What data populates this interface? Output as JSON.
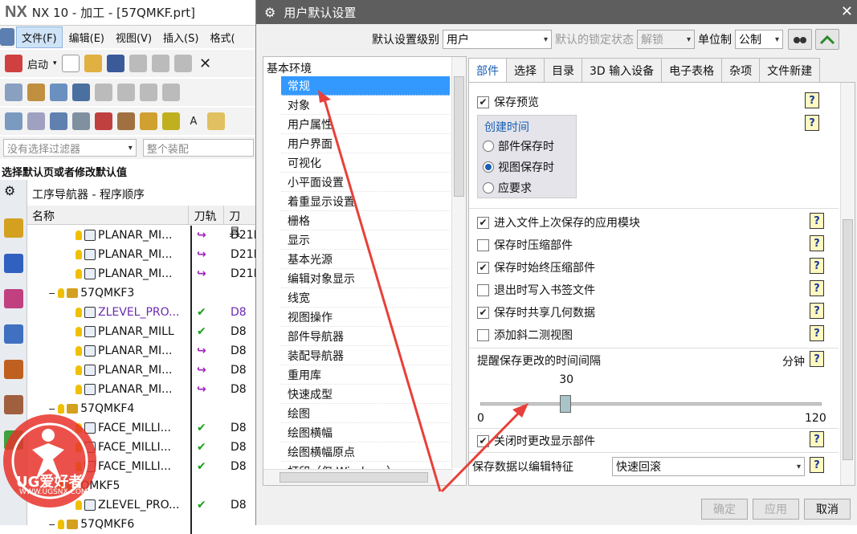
{
  "nx": {
    "logo": "NX",
    "title": "NX 10 - 加工 - [57QMKF.prt]",
    "menus": [
      "文件(F)",
      "编辑(E)",
      "视图(V)",
      "插入(S)",
      "格式("
    ],
    "start_label": "启动",
    "filter_placeholder": "没有选择过滤器",
    "assembly_placeholder": "整个装配",
    "select_hint": "选择默认页或者修改默认值",
    "navigator_title": "工序导航器 - 程序顺序",
    "columns": [
      "名称",
      "刀轨",
      "刀具"
    ],
    "rows": [
      {
        "name": "PLANAR_MI...",
        "path": "↪",
        "tool": "D21I",
        "kind": "op"
      },
      {
        "name": "PLANAR_MI...",
        "path": "↪",
        "tool": "D21I",
        "kind": "op"
      },
      {
        "name": "PLANAR_MI...",
        "path": "↪",
        "tool": "D21I",
        "kind": "op"
      },
      {
        "name": "57QMKF3",
        "path": "",
        "tool": "",
        "kind": "group"
      },
      {
        "name": "ZLEVEL_PRO...",
        "path": "✔",
        "tool": "D8",
        "kind": "op-active"
      },
      {
        "name": "PLANAR_MILL",
        "path": "✔",
        "tool": "D8",
        "kind": "op"
      },
      {
        "name": "PLANAR_MI...",
        "path": "↪",
        "tool": "D8",
        "kind": "op"
      },
      {
        "name": "PLANAR_MI...",
        "path": "↪",
        "tool": "D8",
        "kind": "op"
      },
      {
        "name": "PLANAR_MI...",
        "path": "↪",
        "tool": "D8",
        "kind": "op"
      },
      {
        "name": "57QMKF4",
        "path": "",
        "tool": "",
        "kind": "group"
      },
      {
        "name": "FACE_MILLI...",
        "path": "✔",
        "tool": "D8",
        "kind": "op"
      },
      {
        "name": "FACE_MILLI...",
        "path": "✔",
        "tool": "D8",
        "kind": "op"
      },
      {
        "name": "FACE_MILLI...",
        "path": "✔",
        "tool": "D8",
        "kind": "op"
      },
      {
        "name": "QMKF5",
        "path": "",
        "tool": "",
        "kind": "group"
      },
      {
        "name": "ZLEVEL_PRO...",
        "path": "✔",
        "tool": "D8",
        "kind": "op"
      },
      {
        "name": "57QMKF6",
        "path": "",
        "tool": "",
        "kind": "group"
      }
    ]
  },
  "dialog": {
    "title": "用户默认设置",
    "level_label": "默认设置级别",
    "level_value": "用户",
    "lock_label": "默认的锁定状态",
    "lock_value": "解锁",
    "unit_label": "单位制",
    "unit_value": "公制",
    "tree_root": "基本环境",
    "tree_items": [
      "常规",
      "对象",
      "用户属性",
      "用户界面",
      "可视化",
      "小平面设置",
      "着重显示设置",
      "栅格",
      "显示",
      "基本光源",
      "编辑对象显示",
      "线宽",
      "视图操作",
      "部件导航器",
      "装配导航器",
      "重用库",
      "快速成型",
      "绘图",
      "绘图横幅",
      "绘图横幅原点",
      "打印（仅 Windows）"
    ],
    "selected_item": "常规",
    "tabs": [
      "部件",
      "选择",
      "目录",
      "3D 输入设备",
      "电子表格",
      "杂项",
      "文件新建"
    ],
    "active_tab": "部件",
    "options": {
      "save_preview": {
        "label": "保存预览",
        "checked": true
      },
      "creation_time_group": "创建时间",
      "radios": [
        {
          "label": "部件保存时",
          "selected": false
        },
        {
          "label": "视图保存时",
          "selected": true
        },
        {
          "label": "应要求",
          "selected": false
        }
      ],
      "checkboxes": [
        {
          "label": "进入文件上次保存的应用模块",
          "checked": true
        },
        {
          "label": "保存时压缩部件",
          "checked": false
        },
        {
          "label": "保存时始终压缩部件",
          "checked": true
        },
        {
          "label": "退出时写入书签文件",
          "checked": false
        },
        {
          "label": "保存时共享几何数据",
          "checked": true
        },
        {
          "label": "添加斜二测视图",
          "checked": false
        }
      ],
      "remind_label": "提醒保存更改的时间间隔",
      "remind_unit": "分钟",
      "slider": {
        "value": 30,
        "min": 0,
        "max": 120
      },
      "close_change": {
        "label": "关闭时更改显示部件",
        "checked": true
      },
      "save_data_label": "保存数据以编辑特征",
      "save_data_value": "快速回滚"
    },
    "buttons": {
      "ok": "确定",
      "apply": "应用",
      "cancel": "取消"
    }
  },
  "watermark": {
    "text": "UG爱好者",
    "url": "WWW.UGSNX.COM"
  },
  "colors": {
    "accent": "#1a5fb4",
    "selection": "#3399ff",
    "arrow": "#e8403a"
  }
}
